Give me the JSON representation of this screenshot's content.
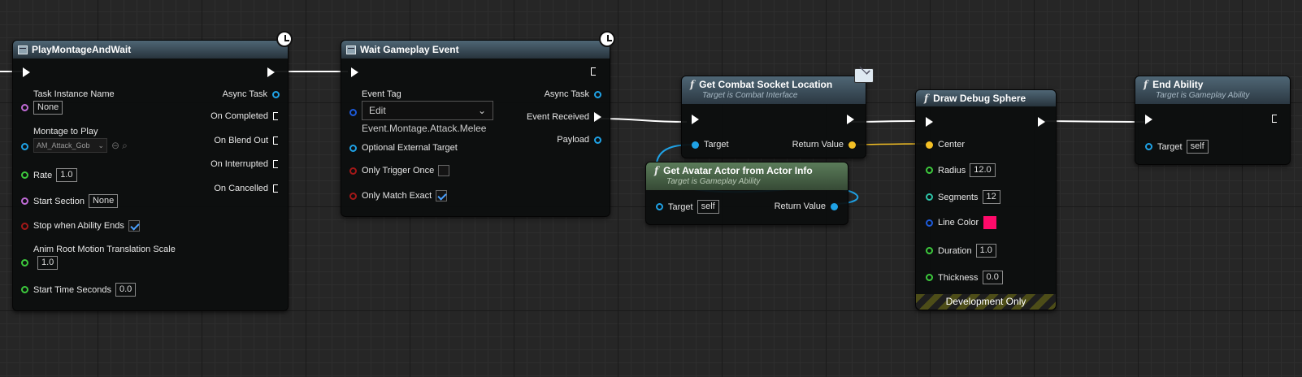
{
  "colors": {
    "exec": "#ffffff",
    "object": "#1fa2e6",
    "struct": "#f4c025",
    "float": "#3dca3d",
    "string": "#c06bd6",
    "bool": "#a31818",
    "tag": "#1d5ad9",
    "color": "#ff0a6a"
  },
  "nodes": {
    "play_montage": {
      "title": "PlayMontageAndWait",
      "inputs": {
        "task_instance_name": "Task Instance Name",
        "task_instance_value": "None",
        "montage": "Montage to Play",
        "montage_value": "AM_Attack_Gob",
        "rate": "Rate",
        "rate_value": "1.0",
        "start_section": "Start Section",
        "start_section_value": "None",
        "stop_when_ends": "Stop when Ability Ends",
        "anim_root": "Anim Root Motion Translation Scale",
        "anim_root_value": "1.0",
        "start_time": "Start Time Seconds",
        "start_time_value": "0.0"
      },
      "outputs": {
        "async_task": "Async Task",
        "on_completed": "On Completed",
        "on_blend_out": "On Blend Out",
        "on_interrupted": "On Interrupted",
        "on_cancelled": "On Cancelled"
      }
    },
    "wait_event": {
      "title": "Wait Gameplay Event",
      "inputs": {
        "event_tag": "Event Tag",
        "event_tag_combo": "Edit",
        "event_tag_value": "Event.Montage.Attack.Melee",
        "optional_target": "Optional External Target",
        "only_trigger_once": "Only Trigger Once",
        "only_match_exact": "Only Match Exact"
      },
      "outputs": {
        "async_task": "Async Task",
        "event_received": "Event Received",
        "payload": "Payload"
      }
    },
    "combat_socket": {
      "title": "Get Combat Socket Location",
      "subtitle": "Target is Combat Interface",
      "target": "Target",
      "return_value": "Return Value"
    },
    "avatar_actor": {
      "title": "Get Avatar Actor from Actor Info",
      "subtitle": "Target is Gameplay Ability",
      "target": "Target",
      "target_value": "self",
      "return_value": "Return Value"
    },
    "debug_sphere": {
      "title": "Draw Debug Sphere",
      "center": "Center",
      "radius": "Radius",
      "radius_value": "12.0",
      "segments": "Segments",
      "segments_value": "12",
      "line_color": "Line Color",
      "duration": "Duration",
      "duration_value": "1.0",
      "thickness": "Thickness",
      "thickness_value": "0.0",
      "footer": "Development Only"
    },
    "end_ability": {
      "title": "End Ability",
      "subtitle": "Target is Gameplay Ability",
      "target": "Target",
      "target_value": "self"
    }
  }
}
